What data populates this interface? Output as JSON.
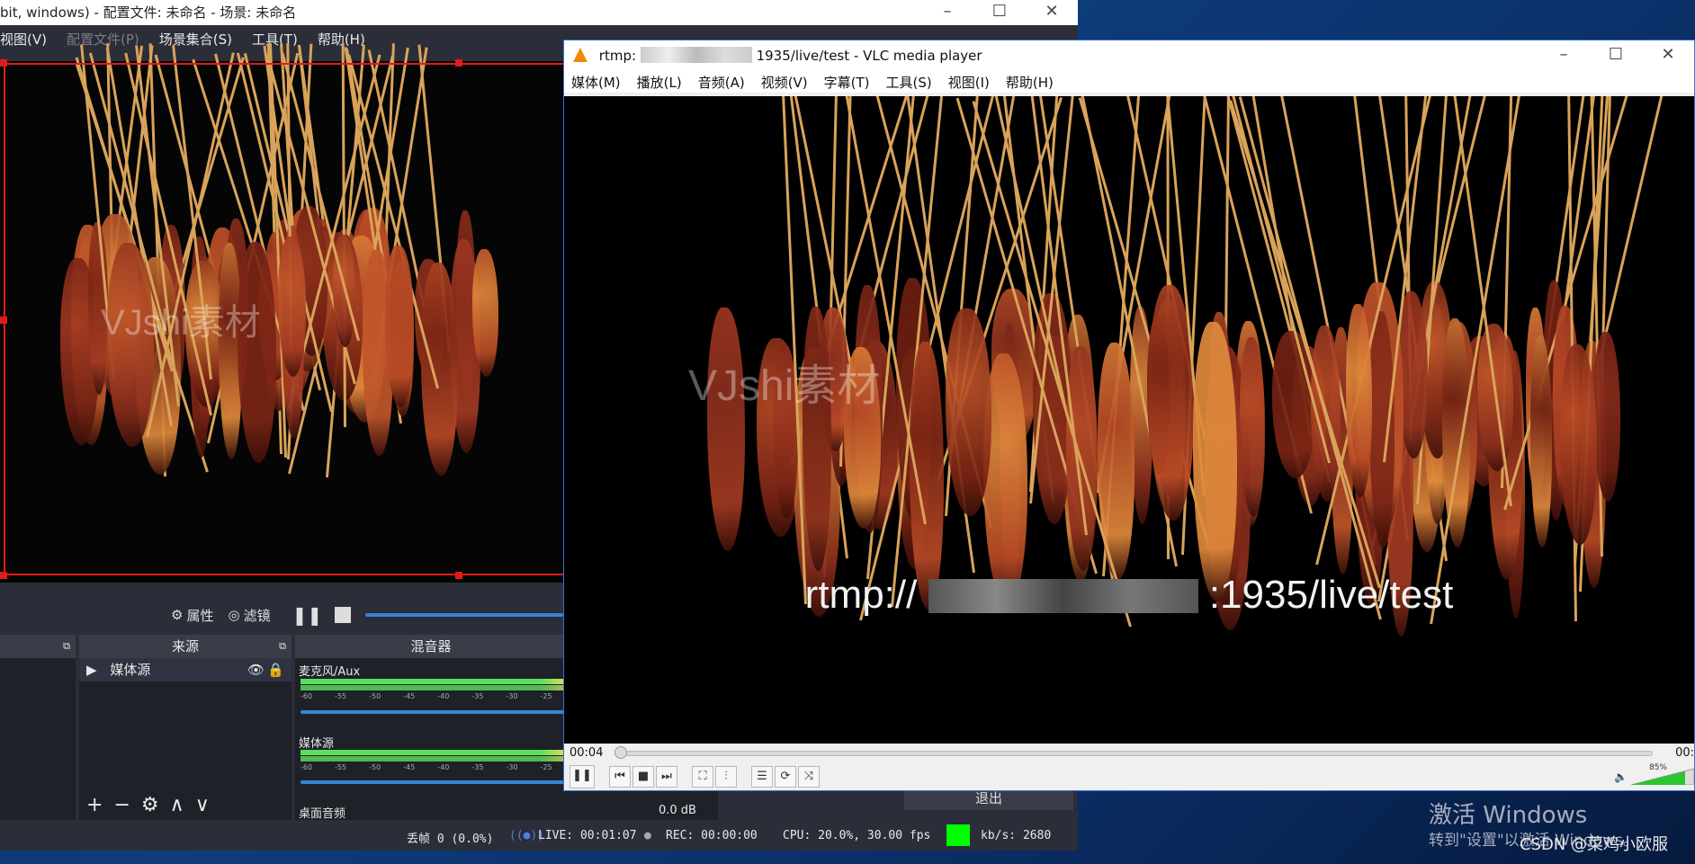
{
  "obs": {
    "title": "bit, windows) - 配置文件: 未命名 - 场景: 未命名",
    "menu": [
      "视图(V)",
      "配置文件(P)",
      "场景集合(S)",
      "工具(T)",
      "帮助(H)"
    ],
    "toolbar": {
      "properties": "属性",
      "filters": "滤镜"
    },
    "docks": {
      "sources": "来源",
      "mixer": "混音器"
    },
    "source_item": "媒体源",
    "mixer": {
      "channels": [
        {
          "name": "麦克风/Aux"
        },
        {
          "name": "媒体源"
        },
        {
          "name": "桌面音频",
          "db": "0.0 dB"
        }
      ],
      "ticks": [
        "-60",
        "-55",
        "-50",
        "-45",
        "-40",
        "-35",
        "-30",
        "-25"
      ]
    },
    "exit_label": "退出",
    "status": {
      "dropped": "丢帧 0 (0.0%)",
      "live": "LIVE: 00:01:07",
      "rec": "REC: 00:00:00",
      "cpu": "CPU: 20.0%, 30.00 fps",
      "kbps": "kb/s: 2680"
    },
    "watermark": "VJshi素材"
  },
  "vlc": {
    "title_prefix": "rtmp:",
    "title_suffix": "1935/live/test - VLC media player",
    "menu": [
      "媒体(M)",
      "播放(L)",
      "音频(A)",
      "视频(V)",
      "字幕(T)",
      "工具(S)",
      "视图(I)",
      "帮助(H)"
    ],
    "overlay_prefix": "rtmp://",
    "overlay_suffix": ":1935/live/test",
    "time_elapsed": "00:04",
    "time_right": "00:",
    "volume": "85%",
    "watermark": "VJshi素材"
  },
  "desktop": {
    "activate_title": "激活 Windows",
    "activate_sub": "转到\"设置\"以激活 Windows。",
    "csdn": "CSDN @菜鸡小欧服"
  },
  "colors": {
    "accent": "#3b82d4",
    "selection": "#e01b1b",
    "live_indicator": "#00ff00"
  }
}
